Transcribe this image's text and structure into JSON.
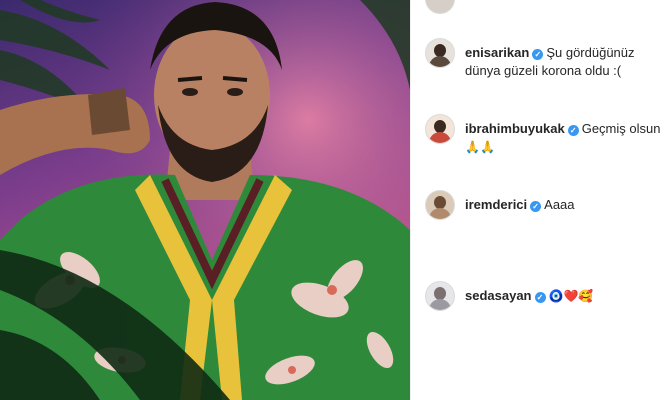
{
  "comments": [
    {
      "username": "enisarikan",
      "verified": true,
      "text": "Şu gördüğünüz dünya güzeli korona oldu :(",
      "avatar_color": "#5a4a3d"
    },
    {
      "username": "ibrahimbuyukak",
      "verified": true,
      "text": "Geçmiş olsun",
      "emoji": "🙏🙏",
      "avatar_color": "#c94a3a"
    },
    {
      "username": "iremderici",
      "verified": true,
      "text": "Aaaa",
      "avatar_color": "#b08a6a"
    },
    {
      "username": "sedasayan",
      "verified": true,
      "text": "",
      "emoji": "🧿❤️🥰",
      "avatar_color": "#9a9aa0"
    }
  ],
  "colors": {
    "verified_badge": "#3897f0",
    "username": "#262626",
    "photo_background": "#7a3d8c"
  }
}
